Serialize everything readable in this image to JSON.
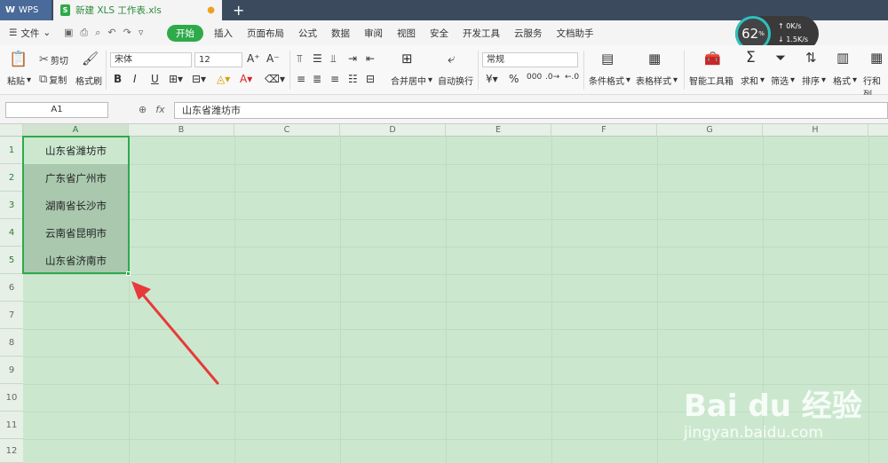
{
  "titlebar": {
    "app_tab": "WPS",
    "doc_tab": "新建 XLS 工作表.xls",
    "new_tab": "+"
  },
  "menubar": {
    "file": "文件",
    "items": [
      "开始",
      "插入",
      "页面布局",
      "公式",
      "数据",
      "审阅",
      "视图",
      "安全",
      "开发工具",
      "云服务",
      "文档助手"
    ]
  },
  "toolbar": {
    "paste": "粘贴",
    "cut": "剪切",
    "copy": "复制",
    "format_painter": "格式刷",
    "font_name": "宋体",
    "font_size": "12",
    "merge_center": "合并居中",
    "auto_wrap": "自动换行",
    "number_format": "常规",
    "conditional_format": "条件格式",
    "table_style": "表格样式",
    "smart_toolbox": "智能工具箱",
    "sum": "求和",
    "filter": "筛选",
    "sort": "排序",
    "format": "格式",
    "rows_cols": "行和列"
  },
  "speed_widget": {
    "percent": "62",
    "unit": "%",
    "up": "0K/s",
    "down": "1.5K/s"
  },
  "formulabar": {
    "name_box": "A1",
    "fx": "fx",
    "value": "山东省潍坊市"
  },
  "columns": [
    "A",
    "B",
    "C",
    "D",
    "E",
    "F",
    "G",
    "H"
  ],
  "rows": [
    "1",
    "2",
    "3",
    "4",
    "5",
    "6",
    "7",
    "8",
    "9",
    "10",
    "11",
    "12"
  ],
  "cells": [
    "山东省潍坊市",
    "广东省广州市",
    "湖南省长沙市",
    "云南省昆明市",
    "山东省济南市"
  ],
  "watermark": {
    "main": "Bai du 经验",
    "sub": "jingyan.baidu.com"
  }
}
